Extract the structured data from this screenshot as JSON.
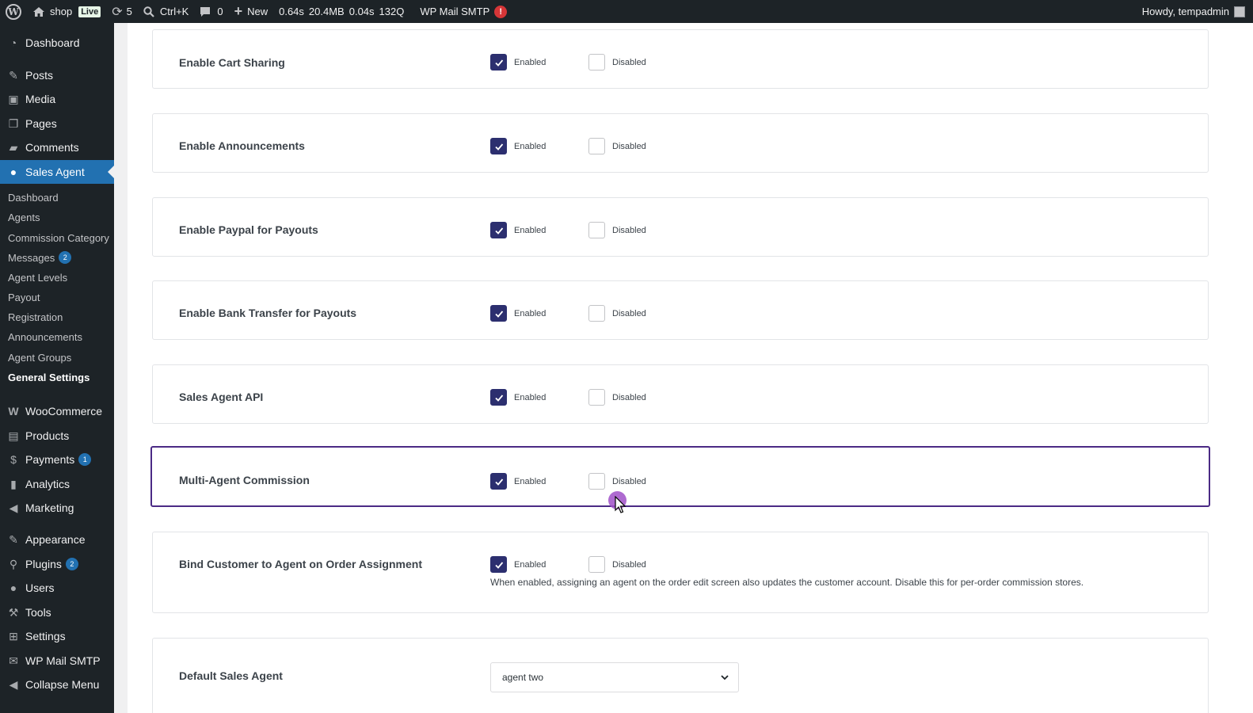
{
  "adminbar": {
    "site_name": "shop",
    "live_label": "Live",
    "updates_count": "5",
    "search_shortcut": "Ctrl+K",
    "comments_count": "0",
    "new_label": "New",
    "metric_time": "0.64s",
    "metric_memory": "20.4MB",
    "metric_db_time": "0.04s",
    "metric_queries": "132Q",
    "smtp_label": "WP Mail SMTP",
    "smtp_alert": "!",
    "howdy": "Howdy, tempadmin"
  },
  "sidebar": {
    "dashboard": "Dashboard",
    "posts": "Posts",
    "media": "Media",
    "pages": "Pages",
    "comments": "Comments",
    "sales_agent": "Sales Agent",
    "submenu": {
      "dashboard": "Dashboard",
      "agents": "Agents",
      "commission_category": "Commission Category",
      "messages": "Messages",
      "messages_count": "2",
      "agent_levels": "Agent Levels",
      "payout": "Payout",
      "registration": "Registration",
      "announcements": "Announcements",
      "agent_groups": "Agent Groups",
      "general_settings": "General Settings"
    },
    "woocommerce": "WooCommerce",
    "products": "Products",
    "payments": "Payments",
    "payments_count": "1",
    "analytics": "Analytics",
    "marketing": "Marketing",
    "appearance": "Appearance",
    "plugins": "Plugins",
    "plugins_count": "2",
    "users": "Users",
    "tools": "Tools",
    "settings": "Settings",
    "wp_mail_smtp": "WP Mail SMTP",
    "collapse": "Collapse Menu"
  },
  "options": {
    "enabled": "Enabled",
    "disabled": "Disabled"
  },
  "settings": {
    "cart_sharing": {
      "label": "Enable Cart Sharing",
      "value": "enabled"
    },
    "announcements": {
      "label": "Enable Announcements",
      "value": "enabled"
    },
    "paypal": {
      "label": "Enable Paypal for Payouts",
      "value": "enabled"
    },
    "bank_transfer": {
      "label": "Enable Bank Transfer for Payouts",
      "value": "enabled"
    },
    "api": {
      "label": "Sales Agent API",
      "value": "enabled"
    },
    "multi_agent": {
      "label": "Multi-Agent Commission",
      "value": "enabled"
    },
    "bind_customer": {
      "label": "Bind Customer to Agent on Order Assignment",
      "value": "enabled",
      "help": "When enabled, assigning an agent on the order edit screen also updates the customer account. Disable this for per-order commission stores."
    },
    "default_agent": {
      "label": "Default Sales Agent",
      "value": "agent two"
    }
  },
  "colors": {
    "accent": "#2271b1",
    "checkbox": "#2c2f6f",
    "highlight_border": "#4b2a85"
  }
}
